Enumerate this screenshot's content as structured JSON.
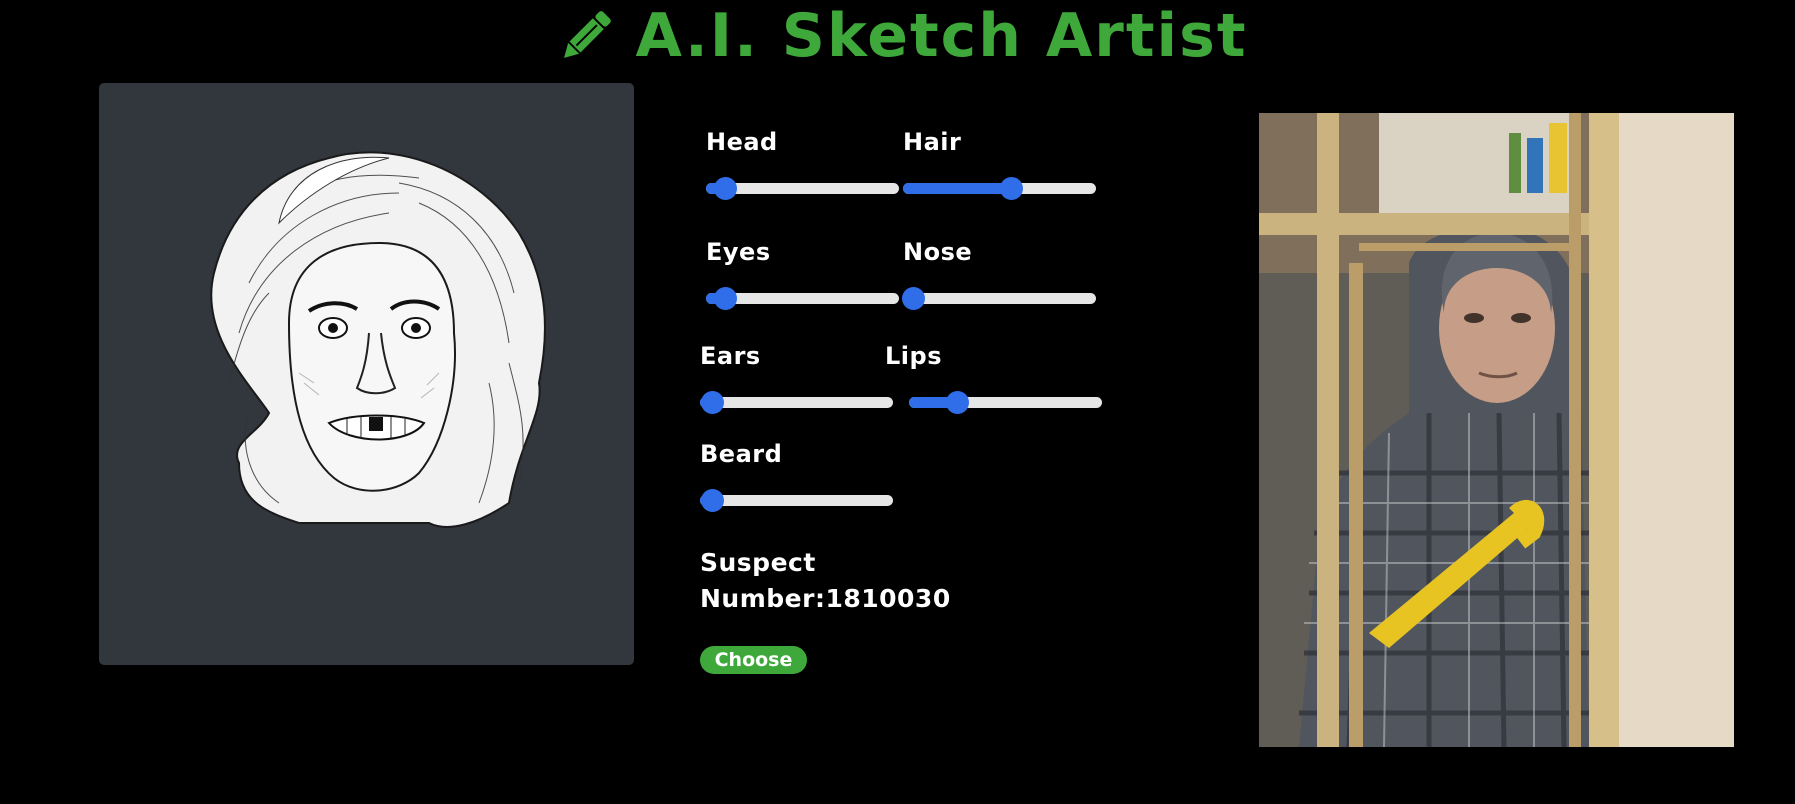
{
  "header": {
    "title": "A.I. Sketch Artist",
    "icon": "pencil-icon",
    "color": "#3fa83a"
  },
  "sketch": {
    "description_icon": "sketch-face-image"
  },
  "sliders": [
    {
      "key": "head",
      "label": "Head",
      "value": 0.1
    },
    {
      "key": "hair",
      "label": "Hair",
      "value": 0.56
    },
    {
      "key": "eyes",
      "label": "Eyes",
      "value": 0.1
    },
    {
      "key": "nose",
      "label": "Nose",
      "value": 0.05
    },
    {
      "key": "ears",
      "label": "Ears",
      "value": 0.06
    },
    {
      "key": "lips",
      "label": "Lips",
      "value": 0.25
    },
    {
      "key": "beard",
      "label": "Beard",
      "value": 0.06
    }
  ],
  "suspect": {
    "label": "Suspect",
    "number_text": "Number:1810030"
  },
  "choose_button": {
    "label": "Choose"
  },
  "colors": {
    "accent": "#3fa83a",
    "slider_blue": "#2f6ee8",
    "panel": "#32363d"
  }
}
